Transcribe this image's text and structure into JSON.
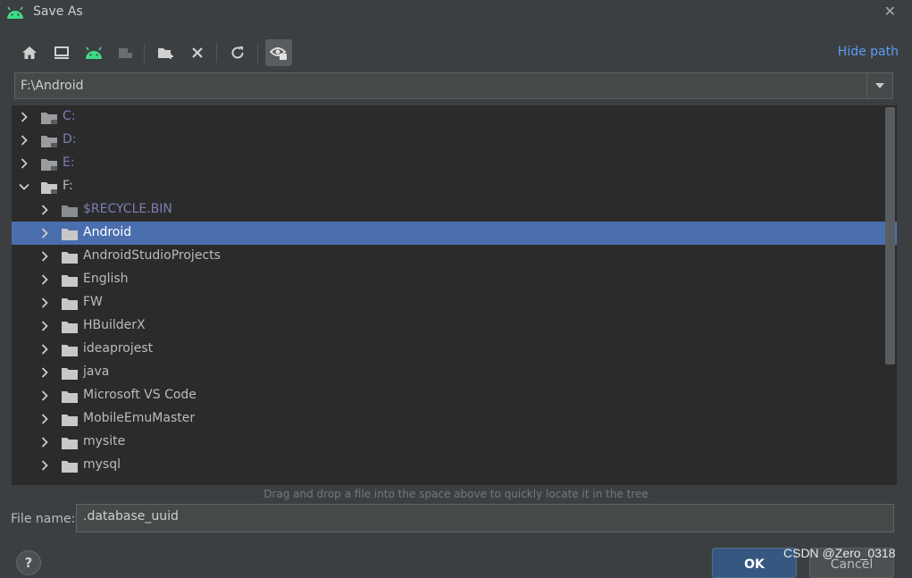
{
  "dialog": {
    "title": "Save As",
    "close_label": "✕"
  },
  "toolbar": {
    "hide_path_label": "Hide path"
  },
  "path": {
    "value": "F:\\Android"
  },
  "tree": {
    "rows": [
      {
        "label": "C:",
        "expanded": false,
        "dim": true,
        "selected": false
      },
      {
        "label": "D:",
        "expanded": false,
        "dim": true,
        "selected": false
      },
      {
        "label": "E:",
        "expanded": false,
        "dim": true,
        "selected": false
      },
      {
        "label": "F:",
        "expanded": true,
        "dim": false,
        "selected": false
      },
      {
        "label": "$RECYCLE.BIN",
        "expanded": false,
        "dim": true,
        "selected": false
      },
      {
        "label": "Android",
        "expanded": false,
        "dim": false,
        "selected": true
      },
      {
        "label": "AndroidStudioProjects",
        "expanded": false,
        "dim": false,
        "selected": false
      },
      {
        "label": "English",
        "expanded": false,
        "dim": false,
        "selected": false
      },
      {
        "label": "FW",
        "expanded": false,
        "dim": false,
        "selected": false
      },
      {
        "label": "HBuilderX",
        "expanded": false,
        "dim": false,
        "selected": false
      },
      {
        "label": "ideaprojest",
        "expanded": false,
        "dim": false,
        "selected": false
      },
      {
        "label": "java",
        "expanded": false,
        "dim": false,
        "selected": false
      },
      {
        "label": "Microsoft VS Code",
        "expanded": false,
        "dim": false,
        "selected": false
      },
      {
        "label": "MobileEmuMaster",
        "expanded": false,
        "dim": false,
        "selected": false
      },
      {
        "label": "mysite",
        "expanded": false,
        "dim": false,
        "selected": false
      },
      {
        "label": "mysql",
        "expanded": false,
        "dim": false,
        "selected": false
      }
    ]
  },
  "hint": "Drag and drop a file into the space above to quickly locate it in the tree",
  "file_name": {
    "label": "File name:",
    "value": ".database_uuid"
  },
  "buttons": {
    "help": "?",
    "ok": "OK",
    "cancel": "Cancel"
  },
  "watermark": "CSDN @Zero_0318",
  "colors": {
    "selection": "#4b6eaf",
    "accent": "#589df6",
    "android_green": "#3ddc84",
    "ok_button": "#365880"
  }
}
